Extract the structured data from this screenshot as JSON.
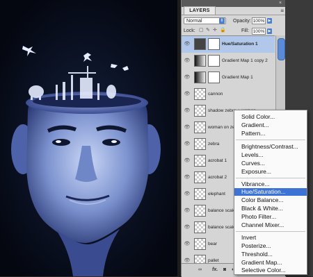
{
  "panel": {
    "tab_label": "LAYERS",
    "blend_mode": "Normal",
    "opacity_label": "Opacity:",
    "opacity_value": "100%",
    "lock_label": "Lock:",
    "fill_label": "Fill:",
    "fill_value": "100%"
  },
  "layers": [
    {
      "name": "Hue/Saturation 1",
      "selected": true
    },
    {
      "name": "Gradient Map 1 copy 2"
    },
    {
      "name": "Gradient Map 1"
    },
    {
      "name": "cannon"
    },
    {
      "name": "shadow zebra + woman"
    },
    {
      "name": "woman on zebra"
    },
    {
      "name": "zebra"
    },
    {
      "name": "acrobat 1"
    },
    {
      "name": "acrobat 2"
    },
    {
      "name": "elephant"
    },
    {
      "name": "balance scale"
    },
    {
      "name": "balance scale"
    },
    {
      "name": "bear"
    },
    {
      "name": "pallet"
    }
  ],
  "menu": {
    "items": [
      "Solid Color...",
      "Gradient...",
      "Pattern...",
      "Brightness/Contrast...",
      "Levels...",
      "Curves...",
      "Exposure...",
      "Vibrance...",
      "Hue/Saturation...",
      "Color Balance...",
      "Black & White...",
      "Photo Filter...",
      "Channel Mixer...",
      "Invert",
      "Posterize...",
      "Threshold...",
      "Gradient Map...",
      "Selective Color..."
    ],
    "highlighted": "Hue/Saturation..."
  },
  "footer": {
    "fx_label": "fx."
  }
}
